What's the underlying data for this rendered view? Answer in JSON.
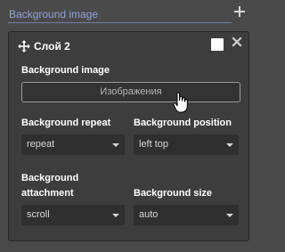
{
  "header": {
    "title": "Background image"
  },
  "layer": {
    "title": "Слой 2",
    "image_label": "Background image",
    "image_button": "Изображения",
    "repeat_label": "Background repeat",
    "repeat_value": "repeat",
    "position_label": "Background position",
    "position_value": "left top",
    "attachment_label_line1": "Background",
    "attachment_label_line2": "attachment",
    "attachment_value": "scroll",
    "size_label": "Background size",
    "size_value": "auto"
  },
  "colors": {
    "header_text": "#8ea3d6",
    "panel_bg": "#3d3d3d",
    "page_bg": "#4a4a4a"
  },
  "icons": [
    "plus-icon",
    "move-icon",
    "close-icon",
    "cursor-hand-icon",
    "chevron-down-icon"
  ]
}
